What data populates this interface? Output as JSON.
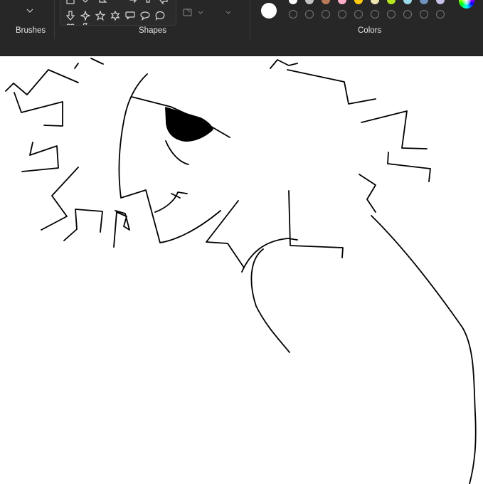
{
  "toolbar": {
    "groups": {
      "brushes": "Brushes",
      "shapes": "Shapes",
      "colors": "Colors"
    },
    "shape_icons": [
      "arrow-down-icon",
      "four-point-star-icon",
      "five-point-star-icon",
      "six-point-star-icon",
      "rect-callout-icon",
      "oval-callout-icon",
      "cloud-callout-icon"
    ],
    "outline_icon": "shape-outline-icon",
    "colors": {
      "primary": "#ffffff",
      "palette_top": [
        "#ffffff",
        "#c3c3c3",
        "#b97a57",
        "#ffaec9",
        "#ffc90e",
        "#efe4b0",
        "#b5e61d",
        "#99d9ea",
        "#7092be",
        "#c8bfe7"
      ],
      "custom_slots": 10
    }
  },
  "canvas": {
    "background": "#ffffff",
    "stroke": "#000000"
  }
}
